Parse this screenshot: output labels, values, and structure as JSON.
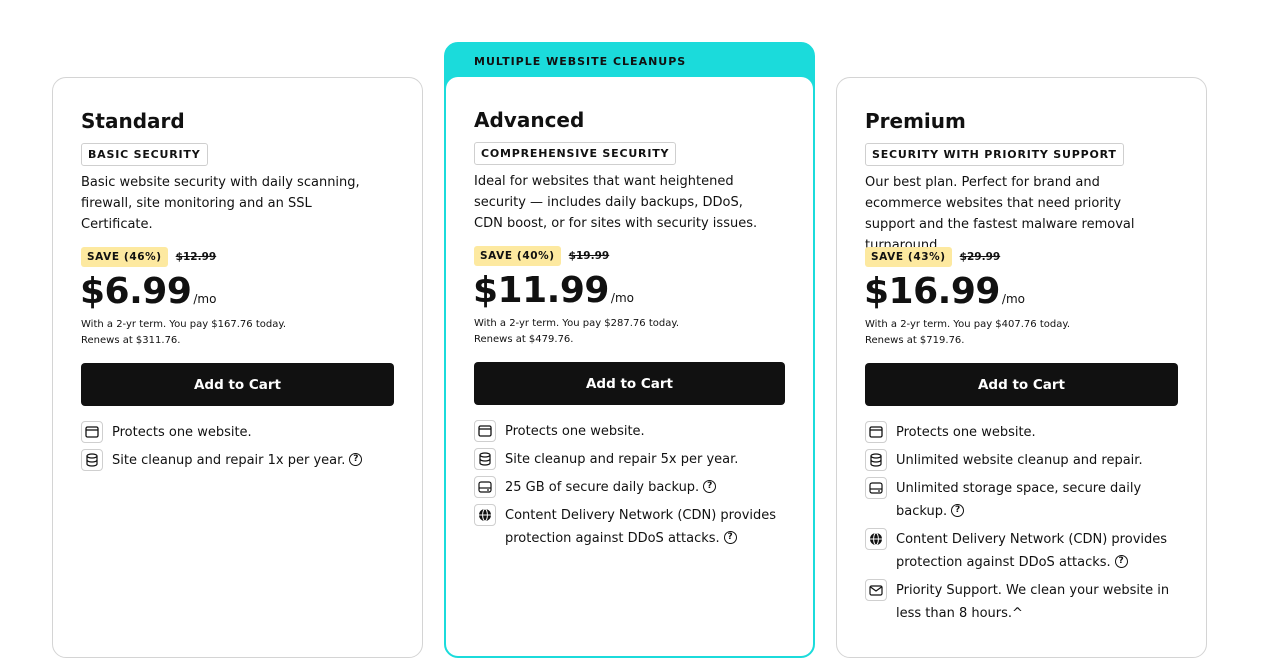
{
  "plans": [
    {
      "name": "Standard",
      "tag": "BASIC SECURITY",
      "description": "Basic website security with daily scanning, firewall, site monitoring and an SSL Certificate.",
      "save": "SAVE (46%)",
      "old_price": "$12.99",
      "price": "$6.99",
      "unit": "/mo",
      "term_line1": "With a 2-yr term. You pay $167.76 today.",
      "term_line2": "Renews at $311.76.",
      "cta": "Add to Cart",
      "features": [
        {
          "icon": "browser-window-icon",
          "text": "Protects one website.",
          "help": false
        },
        {
          "icon": "database-icon",
          "text": "Site cleanup and repair 1x per year.",
          "help": true
        }
      ]
    },
    {
      "banner": "MULTIPLE WEBSITE CLEANUPS",
      "name": "Advanced",
      "tag": "COMPREHENSIVE SECURITY",
      "description": "Ideal for websites that want heightened security — includes daily backups, DDoS, CDN boost, or for sites with security issues.",
      "save": "SAVE (40%)",
      "old_price": "$19.99",
      "price": "$11.99",
      "unit": "/mo",
      "term_line1": "With a 2-yr term. You pay $287.76 today.",
      "term_line2": "Renews at $479.76.",
      "cta": "Add to Cart",
      "features": [
        {
          "icon": "browser-window-icon",
          "text": "Protects one website.",
          "help": false
        },
        {
          "icon": "database-icon",
          "text": "Site cleanup and repair 5x per year.",
          "help": false
        },
        {
          "icon": "hard-drive-icon",
          "text": "25 GB of secure daily backup.",
          "help": true
        },
        {
          "icon": "globe-icon",
          "text": "Content Delivery Network (CDN) provides protection against DDoS attacks.",
          "help": true
        }
      ]
    },
    {
      "name": "Premium",
      "tag": "SECURITY WITH PRIORITY SUPPORT",
      "description": "Our best plan. Perfect for brand and ecommerce websites that need priority support and the fastest malware removal turnaround.",
      "save": "SAVE (43%)",
      "old_price": "$29.99",
      "price": "$16.99",
      "unit": "/mo",
      "term_line1": "With a 2-yr term. You pay $407.76 today.",
      "term_line2": "Renews at $719.76.",
      "cta": "Add to Cart",
      "features": [
        {
          "icon": "browser-window-icon",
          "text": "Protects one website.",
          "help": false
        },
        {
          "icon": "database-icon",
          "text": "Unlimited website cleanup and repair.",
          "help": false
        },
        {
          "icon": "hard-drive-icon",
          "text": "Unlimited storage space, secure daily backup.",
          "help": true
        },
        {
          "icon": "globe-icon",
          "text": "Content Delivery Network (CDN) provides protection against DDoS attacks.",
          "help": true
        },
        {
          "icon": "envelope-icon",
          "text": "Priority Support. We clean your website in less than 8 hours.^",
          "help": false
        }
      ]
    }
  ]
}
